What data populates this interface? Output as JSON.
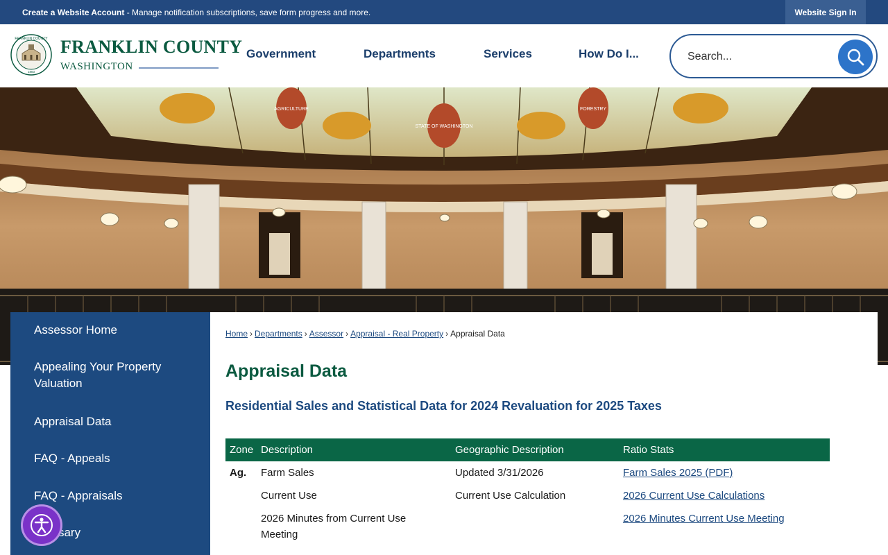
{
  "topbar": {
    "account_bold": "Create a Website Account",
    "account_rest": " - Manage notification subscriptions, save form progress and more.",
    "signin": "Website Sign In"
  },
  "brand": {
    "seal_top": "FRANKLIN COUNTY",
    "seal_year": "1883",
    "title": "FRANKLIN COUNTY",
    "subtitle": "WASHINGTON"
  },
  "nav": [
    "Government",
    "Departments",
    "Services",
    "How Do I..."
  ],
  "search": {
    "placeholder": "Search..."
  },
  "banner": {
    "dome_words": [
      "AGRICULTURE",
      "STATE OF WASHINGTON",
      "FORESTRY"
    ]
  },
  "sidebar": {
    "items": [
      "Assessor Home",
      "Appealing Your Property Valuation",
      "Appraisal Data",
      "FAQ - Appeals",
      "FAQ - Appraisals",
      "Glossary"
    ]
  },
  "breadcrumb": {
    "links": [
      "Home",
      "Departments",
      "Assessor",
      "Appraisal - Real Property"
    ],
    "current": "Appraisal Data"
  },
  "page": {
    "title": "Appraisal Data",
    "subhead": "Residential Sales and Statistical Data for 2024 Revaluation for 2025 Taxes"
  },
  "table": {
    "headers": [
      "Zone",
      "Description",
      "Geographic Description",
      "Ratio Stats"
    ],
    "rows": [
      {
        "zone": "Ag.",
        "description": "Farm Sales",
        "geo": "Updated 3/31/2026",
        "ratio": "Farm Sales 2025 (PDF)"
      },
      {
        "zone": "",
        "description": "Current Use",
        "geo": "Current Use Calculation",
        "ratio": "2026 Current Use Calculations"
      },
      {
        "zone": "",
        "description": "2026 Minutes from Current Use Meeting",
        "geo": "",
        "ratio": "2026 Minutes Current Use Meeting"
      }
    ]
  },
  "colors": {
    "topbar": "#23497f",
    "brand_green": "#0b5a40",
    "sidebar": "#1d4a80",
    "table_header": "#0a6646",
    "search_button": "#2d74c9",
    "accessibility": "#7a32c8"
  },
  "icons": {
    "search": "search-icon",
    "accessibility": "accessibility-icon",
    "seal": "county-seal-icon"
  }
}
